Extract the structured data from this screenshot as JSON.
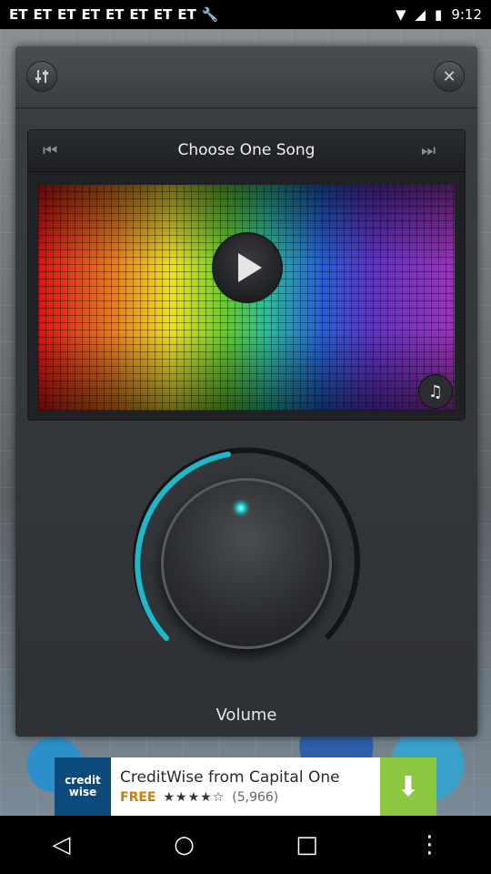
{
  "status_bar": {
    "time": "9:12",
    "notification_icons": [
      "ET",
      "ET",
      "ET",
      "ET",
      "ET",
      "ET",
      "ET",
      "ET"
    ]
  },
  "popup": {
    "eq_button_icon": "equalizer-icon",
    "close_button_icon": "close-icon",
    "player": {
      "title": "Choose One Song",
      "prev_icon": "skip-previous-icon",
      "next_icon": "skip-next-icon"
    },
    "volume_label": "Volume",
    "volume_level": 0.4
  },
  "ad": {
    "logo_text": "credit wise",
    "title": "CreditWise from Capital One",
    "free": "FREE",
    "rating_stars": "★★★★☆",
    "rating_count": "(5,966)"
  },
  "colors": {
    "accent": "#1fb8c8",
    "popup_bg": "#2e3135",
    "ad_download_bg": "#8dc63f"
  }
}
